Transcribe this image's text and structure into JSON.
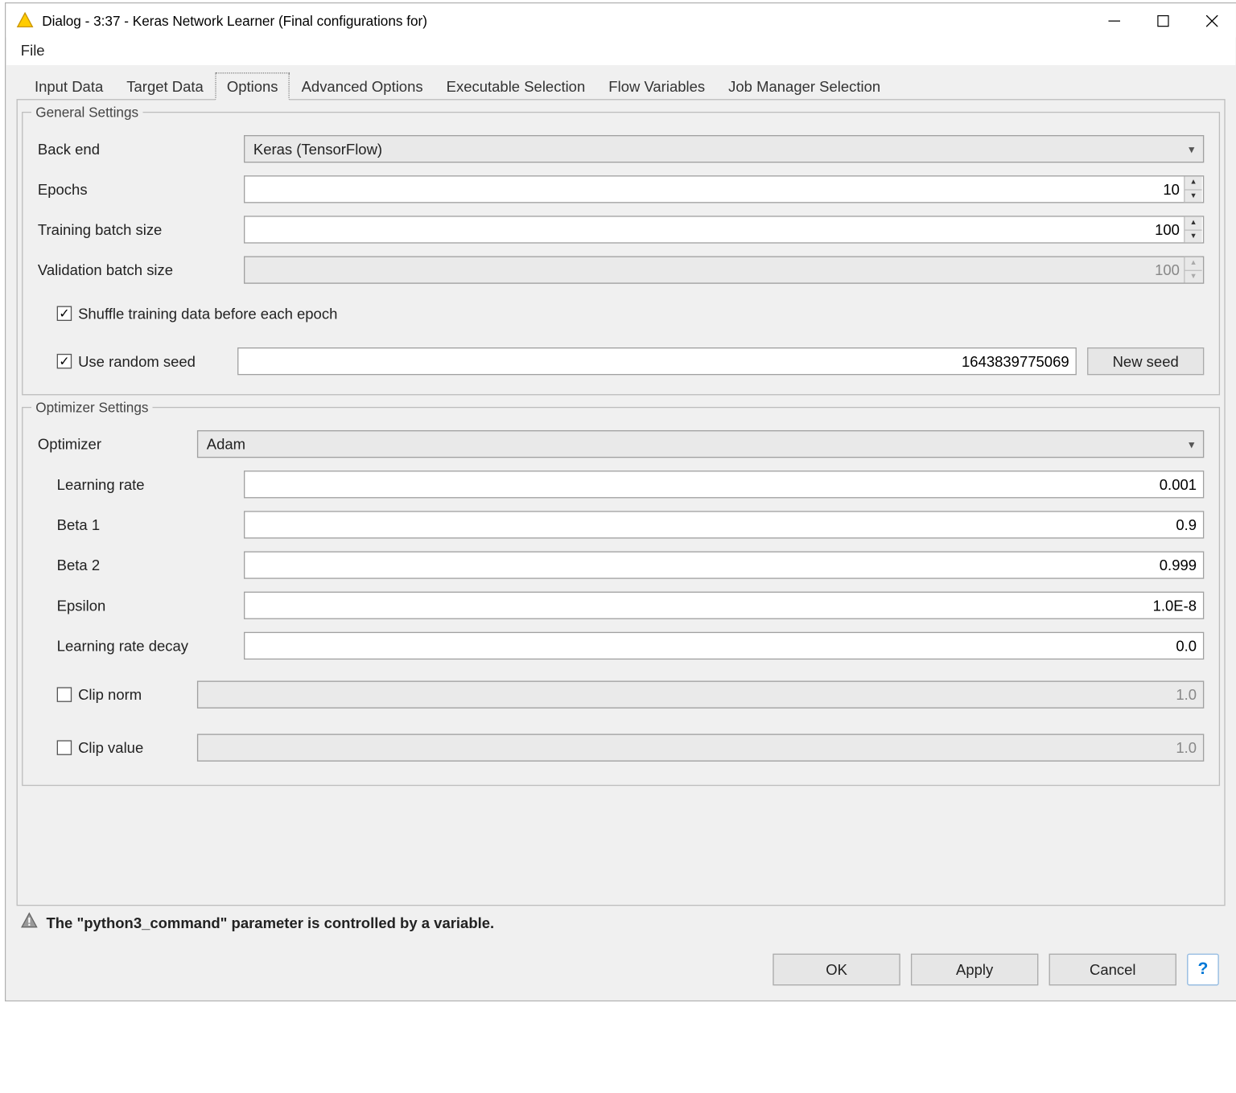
{
  "window": {
    "title": "Dialog - 3:37 - Keras Network Learner (Final configurations for)"
  },
  "menu": {
    "file": "File"
  },
  "tabs": {
    "input_data": "Input Data",
    "target_data": "Target Data",
    "options": "Options",
    "advanced_options": "Advanced Options",
    "executable_selection": "Executable Selection",
    "flow_variables": "Flow Variables",
    "job_manager_selection": "Job Manager Selection"
  },
  "general": {
    "legend": "General Settings",
    "backend_label": "Back end",
    "backend_value": "Keras (TensorFlow)",
    "epochs_label": "Epochs",
    "epochs_value": "10",
    "train_batch_label": "Training batch size",
    "train_batch_value": "100",
    "valid_batch_label": "Validation batch size",
    "valid_batch_value": "100",
    "shuffle_label": "Shuffle training data before each epoch",
    "shuffle_checked": true,
    "use_seed_label": "Use random seed",
    "use_seed_checked": true,
    "seed_value": "1643839775069",
    "new_seed_btn": "New seed"
  },
  "optimizer": {
    "legend": "Optimizer Settings",
    "optimizer_label": "Optimizer",
    "optimizer_value": "Adam",
    "lr_label": "Learning rate",
    "lr_value": "0.001",
    "beta1_label": "Beta 1",
    "beta1_value": "0.9",
    "beta2_label": "Beta 2",
    "beta2_value": "0.999",
    "epsilon_label": "Epsilon",
    "epsilon_value": "1.0E-8",
    "lr_decay_label": "Learning rate decay",
    "lr_decay_value": "0.0",
    "clip_norm_label": "Clip norm",
    "clip_norm_checked": false,
    "clip_norm_value": "1.0",
    "clip_value_label": "Clip value",
    "clip_value_checked": false,
    "clip_value_value": "1.0"
  },
  "status": {
    "message": "The \"python3_command\" parameter is controlled by a variable."
  },
  "buttons": {
    "ok": "OK",
    "apply": "Apply",
    "cancel": "Cancel"
  }
}
